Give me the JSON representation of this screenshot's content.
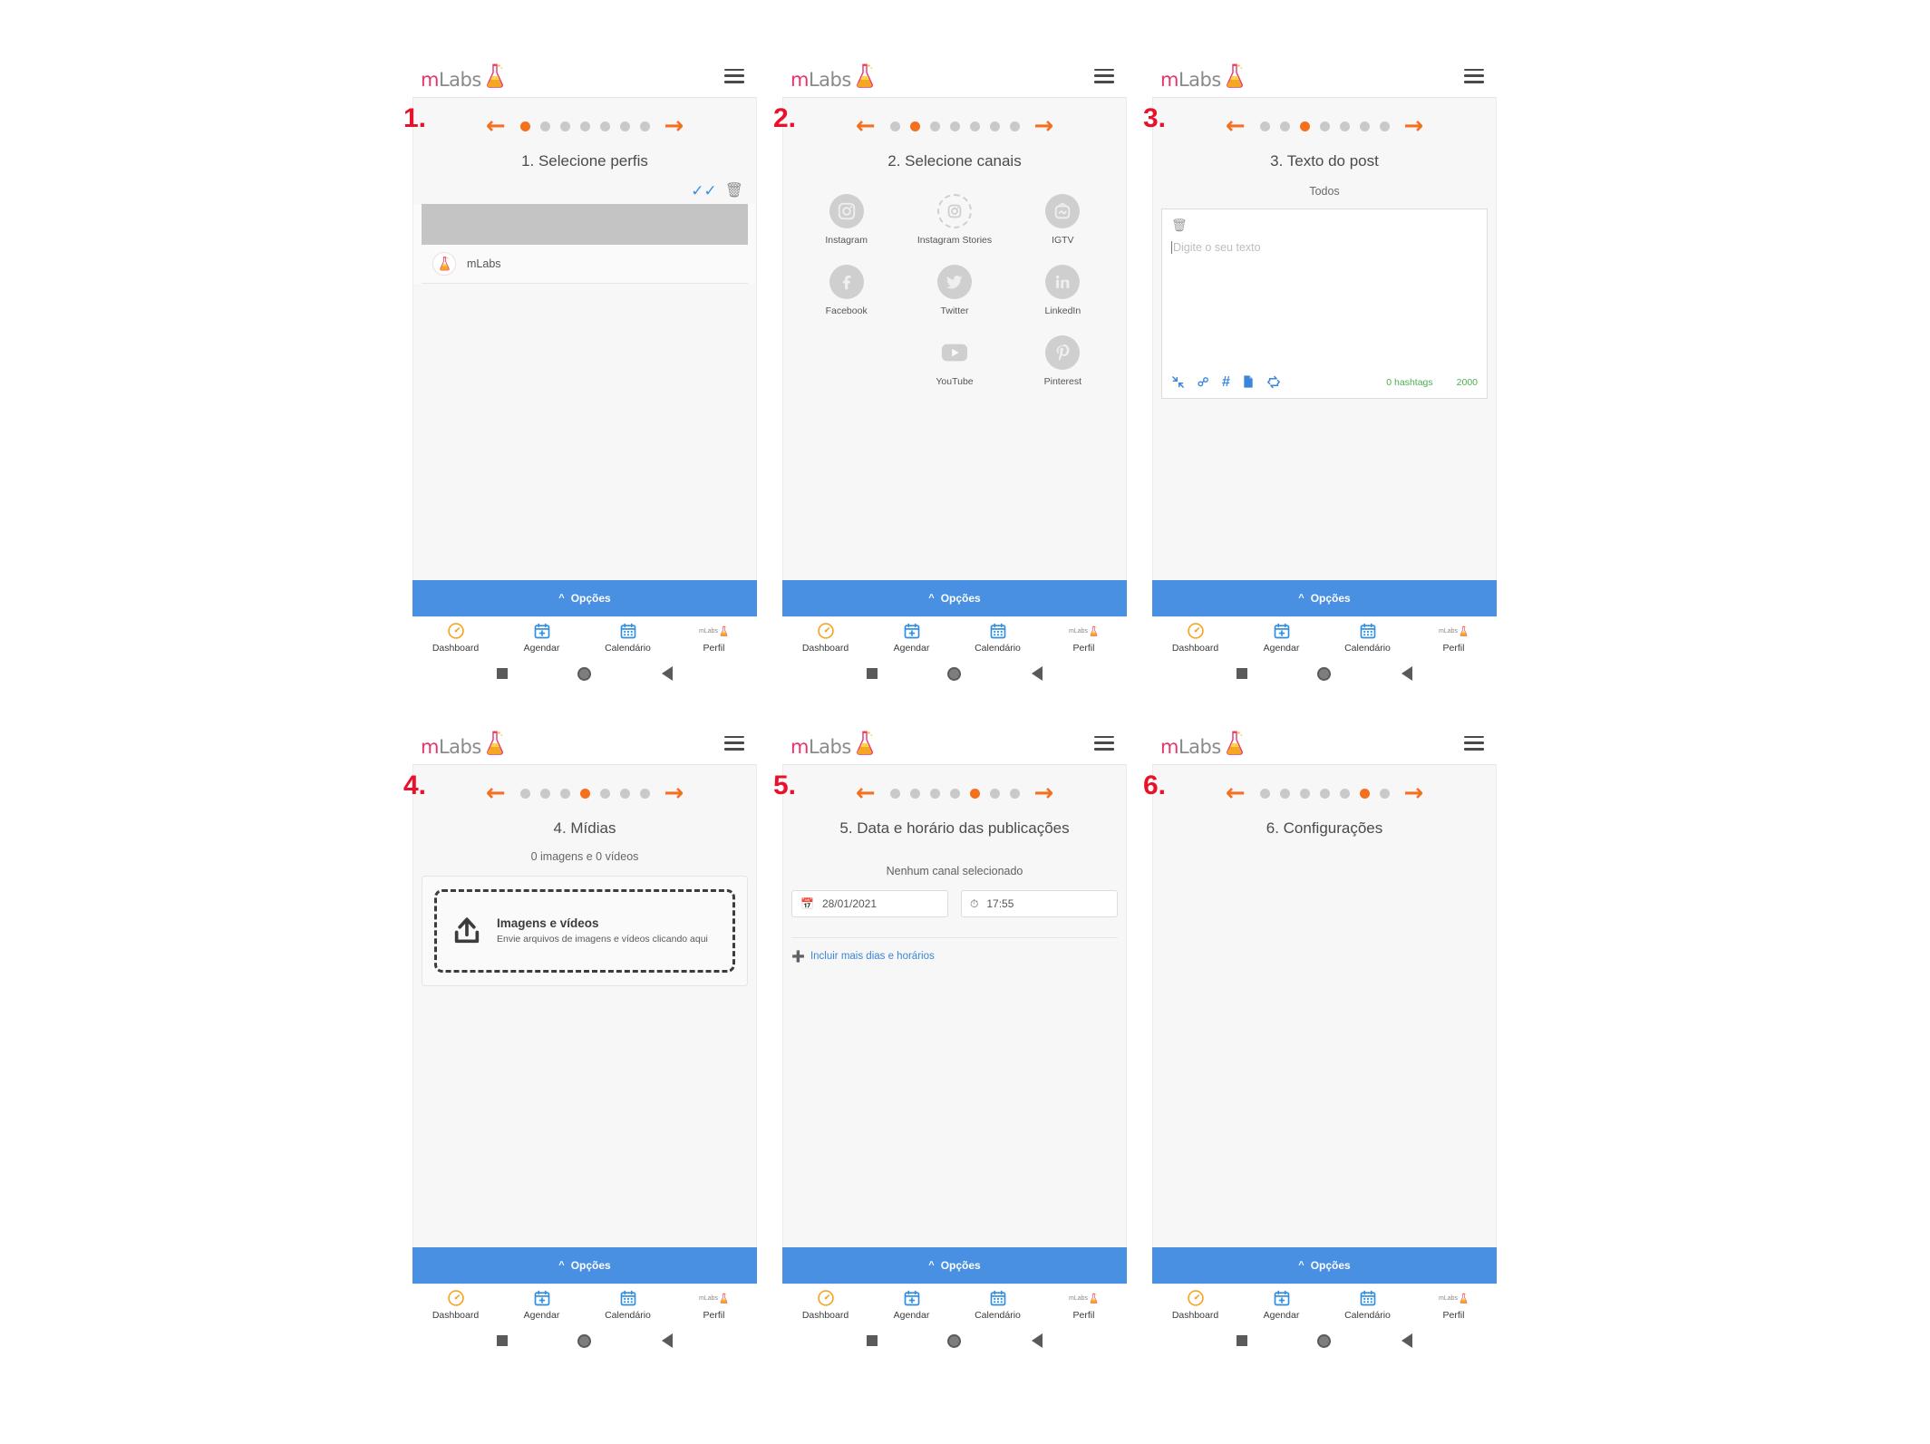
{
  "brand": {
    "name_m": "m",
    "name_rest": "Labs",
    "flask_icon": "flask-icon",
    "menu_icon": "hamburger-menu-icon",
    "logo_colors": {
      "m": "#e8336b",
      "labs": "#8a8a8a",
      "flask": "#f5a623"
    }
  },
  "colors": {
    "accent_orange": "#f4701f",
    "step_number_red": "#e8132b",
    "options_blue": "#4a90e2",
    "link_blue": "#3b86d8",
    "counter_green": "#4caf50",
    "disabled_gray": "#cfcfcf"
  },
  "pager": {
    "prev_icon": "arrow-left-icon",
    "next_icon": "arrow-right-icon",
    "total_dots": 7
  },
  "options_bar": {
    "label": "Opções",
    "caret_icon": "chevron-up-icon"
  },
  "tabs": [
    {
      "label": "Dashboard",
      "icon": "speedometer-icon",
      "color": "#f5a623"
    },
    {
      "label": "Agendar",
      "icon": "calendar-plus-icon",
      "color": "#2f8ee0"
    },
    {
      "label": "Calendário",
      "icon": "calendar-icon",
      "color": "#2f8ee0"
    },
    {
      "label": "Perfil",
      "icon": "mlabs-logo-icon",
      "color": "#e8336b"
    }
  ],
  "android_nav": {
    "recents_icon": "square-icon",
    "home_icon": "circle-icon",
    "back_icon": "triangle-back-icon"
  },
  "screens": [
    {
      "step_label": "1.",
      "active_dot": 0,
      "title": "1. Selecione perfis",
      "actions": {
        "select_all_icon": "double-check-icon",
        "delete_icon": "trash-icon"
      },
      "profiles": [
        {
          "name": "mLabs",
          "avatar_icon": "mlabs-avatar-icon"
        }
      ]
    },
    {
      "step_label": "2.",
      "active_dot": 1,
      "title": "2. Selecione canais",
      "channels": [
        {
          "label": "Instagram",
          "icon": "instagram-icon",
          "style": "solid"
        },
        {
          "label": "Instagram Stories",
          "icon": "instagram-stories-icon",
          "style": "dashed"
        },
        {
          "label": "IGTV",
          "icon": "igtv-icon",
          "style": "solid"
        },
        {
          "label": "Facebook",
          "icon": "facebook-icon",
          "style": "solid"
        },
        {
          "label": "Twitter",
          "icon": "twitter-icon",
          "style": "solid"
        },
        {
          "label": "LinkedIn",
          "icon": "linkedin-icon",
          "style": "solid"
        },
        {
          "label": "YouTube",
          "icon": "youtube-icon",
          "style": "youtube"
        },
        {
          "label": "Pinterest",
          "icon": "pinterest-icon",
          "style": "solid"
        }
      ]
    },
    {
      "step_label": "3.",
      "active_dot": 2,
      "title": "3. Texto do post",
      "channel_filter": "Todos",
      "editor": {
        "trash_icon": "trash-icon",
        "placeholder": "Digite o seu texto",
        "value": "",
        "toolbar_icons": [
          "collapse-icon",
          "link-icon",
          "hashtag-icon",
          "document-icon",
          "repost-icon"
        ],
        "hashtag_count": "0 hashtags",
        "char_limit": "2000"
      }
    },
    {
      "step_label": "4.",
      "active_dot": 3,
      "title": "4. Mídias",
      "media_count": "0 imagens e 0 vídeos",
      "dropzone": {
        "upload_icon": "upload-icon",
        "title": "Imagens e vídeos",
        "subtitle": "Envie arquivos de imagens e vídeos clicando aqui"
      }
    },
    {
      "step_label": "5.",
      "active_dot": 4,
      "title": "5. Data e horário das publicações",
      "no_channel": "Nenhum canal selecionado",
      "date_field": {
        "icon": "calendar-icon",
        "value": "28/01/2021"
      },
      "time_field": {
        "icon": "clock-icon",
        "value": "17:55"
      },
      "add_more": {
        "icon": "plus-circle-icon",
        "label": "Incluir mais dias e horários"
      }
    },
    {
      "step_label": "6.",
      "active_dot": 5,
      "title": "6. Configurações"
    }
  ]
}
